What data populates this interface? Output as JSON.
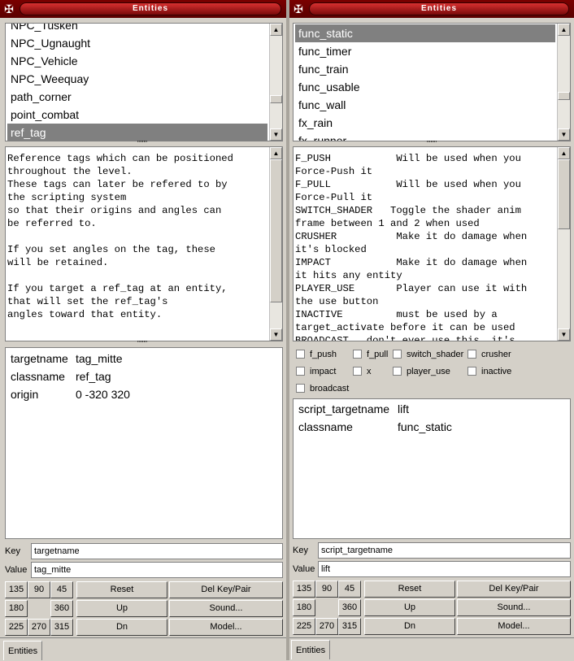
{
  "left": {
    "title": "Entities",
    "class_list": [
      "NPC_Tusken",
      "NPC_Ugnaught",
      "NPC_Vehicle",
      "NPC_Weequay",
      "path_corner",
      "point_combat",
      "ref_tag"
    ],
    "selected_class": "ref_tag",
    "description": "Reference tags which can be positioned\nthroughout the level.\nThese tags can later be refered to by\nthe scripting system\nso that their origins and angles can\nbe referred to.\n\nIf you set angles on the tag, these\nwill be retained.\n\nIf you target a ref_tag at an entity,\nthat will set the ref_tag's\nangles toward that entity.",
    "properties": [
      {
        "key": "targetname",
        "value": "tag_mitte"
      },
      {
        "key": "classname",
        "value": "ref_tag"
      },
      {
        "key": "origin",
        "value": "0 -320 320"
      }
    ],
    "key_label": "Key",
    "value_label": "Value",
    "key_value": "targetname",
    "value_value": "tag_mitte",
    "angle_buttons": [
      "135",
      "90",
      "45",
      "180",
      "",
      "360",
      "225",
      "270",
      "315"
    ],
    "reset_label": "Reset",
    "up_label": "Up",
    "dn_label": "Dn",
    "delkey_label": "Del Key/Pair",
    "sound_label": "Sound...",
    "model_label": "Model...",
    "tab_label": "Entities"
  },
  "right": {
    "title": "Entities",
    "class_list": [
      "func_static",
      "func_timer",
      "func_train",
      "func_usable",
      "func_wall",
      "fx_rain",
      "fx_runner"
    ],
    "selected_class": "func_static",
    "description": "F_PUSH           Will be used when you\nForce-Push it\nF_PULL           Will be used when you\nForce-Pull it\nSWITCH_SHADER   Toggle the shader anim\nframe between 1 and 2 when used\nCRUSHER          Make it do damage when\nit's blocked\nIMPACT           Make it do damage when\nit hits any entity\nPLAYER_USE       Player can use it with\nthe use button\nINACTIVE         must be used by a\ntarget_activate before it can be used\nBROADCAST   don't ever use this, it's",
    "spawnflags": [
      "f_push",
      "f_pull",
      "switch_shader",
      "crusher",
      "impact",
      "x",
      "player_use",
      "inactive",
      "broadcast"
    ],
    "properties": [
      {
        "key": "script_targetname",
        "value": "lift"
      },
      {
        "key": "classname",
        "value": "func_static"
      }
    ],
    "key_label": "Key",
    "value_label": "Value",
    "key_value": "script_targetname",
    "value_value": "lift",
    "angle_buttons": [
      "135",
      "90",
      "45",
      "180",
      "",
      "360",
      "225",
      "270",
      "315"
    ],
    "reset_label": "Reset",
    "up_label": "Up",
    "dn_label": "Dn",
    "delkey_label": "Del Key/Pair",
    "sound_label": "Sound...",
    "model_label": "Model...",
    "tab_label": "Entities"
  }
}
